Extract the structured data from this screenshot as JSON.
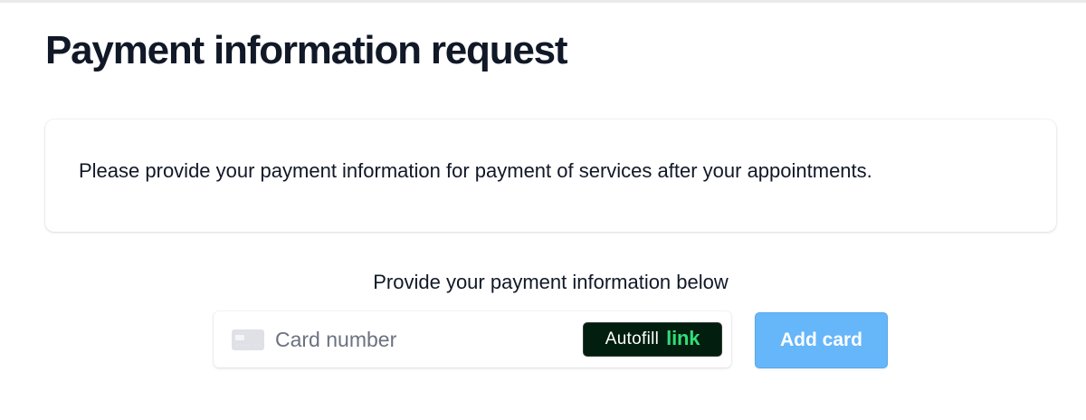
{
  "page": {
    "title": "Payment information request"
  },
  "info_card": {
    "text": "Please provide your payment information for payment of services after your appointments."
  },
  "payment_section": {
    "label": "Provide your payment information below",
    "card_field": {
      "placeholder": "Card number",
      "value": "",
      "card_icon_digits": "---- ----",
      "icon": "credit-card-icon"
    },
    "autofill_button": {
      "label": "Autofill",
      "brand": "link"
    },
    "add_card_button": {
      "label": "Add card"
    }
  },
  "colors": {
    "title_text": "#111827",
    "add_card_bg": "#66b6fa",
    "autofill_bg": "#011e0f",
    "link_green": "#33dd77"
  }
}
